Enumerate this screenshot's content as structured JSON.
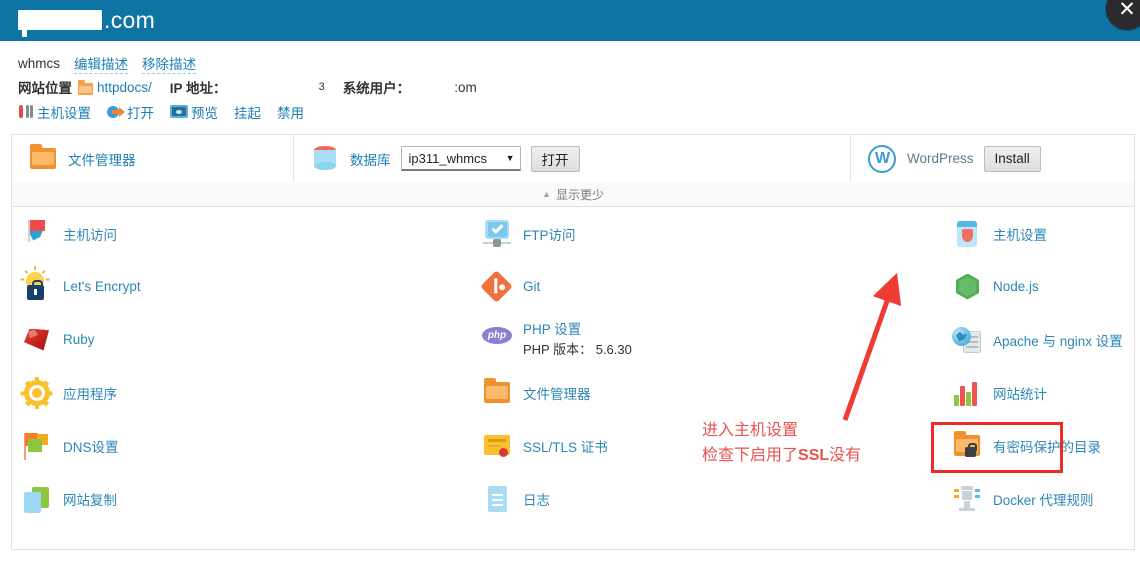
{
  "header": {
    "domain_redacted": true,
    "domain_tld": ".com",
    "close_icon": "close-icon"
  },
  "info": {
    "description_label": "whmcs",
    "edit_description_link": "编辑描述",
    "remove_description_link": "移除描述",
    "site_location_label": "网站位置",
    "site_location_value": "httpdocs/",
    "ip_label": "IP 地址：",
    "ip_value_suffix": "3",
    "system_user_label": "系统用户：",
    "system_user_suffix": ":om",
    "tools": [
      {
        "label": "主机设置",
        "icon": "wrench-tools-icon"
      },
      {
        "label": "打开",
        "icon": "open-arrow-icon"
      },
      {
        "label": "预览",
        "icon": "preview-monitor-icon"
      },
      {
        "label": "挂起",
        "icon": ""
      },
      {
        "label": "禁用",
        "icon": ""
      }
    ]
  },
  "cards": {
    "file_manager_label": "文件管理器",
    "database_label": "数据库",
    "database_selected": "ip311_whmcs",
    "database_open_button": "打开",
    "wordpress_label": "WordPress",
    "wordpress_install_button": "Install"
  },
  "show_less": {
    "label": "显示更少",
    "chevron": "▲"
  },
  "grid": {
    "columns": [
      {
        "items": [
          {
            "label": "主机访问",
            "icon": "globe-flag-icon"
          },
          {
            "label": "Let's Encrypt",
            "icon": "lets-encrypt-lock-icon"
          },
          {
            "label": "Ruby",
            "icon": "ruby-gem-icon"
          },
          {
            "label": "应用程序",
            "icon": "gear-icon"
          },
          {
            "label": "DNS设置",
            "icon": "dns-flags-icon"
          },
          {
            "label": "网站复制",
            "icon": "copy-pages-icon"
          }
        ]
      },
      {
        "items": [
          {
            "label": "FTP访问",
            "icon": "ftp-monitor-icon"
          },
          {
            "label": "Git",
            "icon": "git-diamond-icon"
          },
          {
            "label": "PHP 设置",
            "sub": "PHP 版本： 5.6.30",
            "icon": "php-icon"
          },
          {
            "label": "文件管理器",
            "icon": "folder-icon"
          },
          {
            "label": "SSL/TLS 证书",
            "icon": "certificate-icon"
          },
          {
            "label": "日志",
            "icon": "log-document-icon"
          }
        ]
      },
      {
        "items": [
          {
            "label": "主机设置",
            "icon": "hosting-settings-icon",
            "highlighted": true
          },
          {
            "label": "Node.js",
            "icon": "nodejs-hexagon-icon"
          },
          {
            "label": "Apache 与 nginx 设置",
            "icon": "apache-nginx-server-icon"
          },
          {
            "label": "网站统计",
            "icon": "bar-chart-icon"
          },
          {
            "label": "有密码保护的目录",
            "icon": "protected-folder-lock-icon"
          },
          {
            "label": "Docker 代理规则",
            "icon": "docker-proxy-icon"
          }
        ]
      }
    ]
  },
  "annotation": {
    "line1": "进入主机设置",
    "line2_prefix": "检查下启用了",
    "line2_bold": "SSL",
    "line2_suffix": "没有",
    "color": "#e8524f",
    "arrow": "red-arrow-pointing-up-right"
  },
  "colors": {
    "header_blue": "#0d74a4",
    "link_blue": "#1b7fb5",
    "grid_link_blue": "#2e86b6",
    "highlight_red": "#ef2b28",
    "annotation_red": "#e8524f"
  }
}
